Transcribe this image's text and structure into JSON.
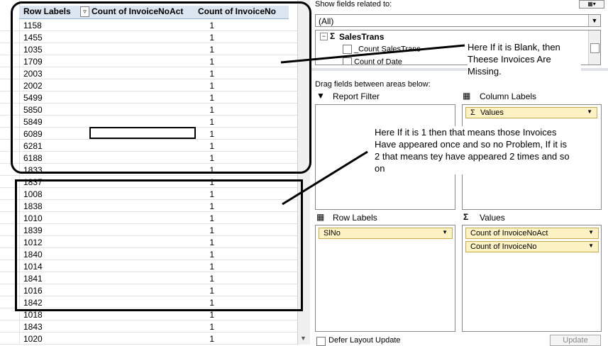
{
  "pivot": {
    "header": {
      "row_labels": "Row Labels",
      "col1": "Count of InvoiceNoAct",
      "col2": "Count of InvoiceNo",
      "filter_icon": "filter-sort-icon"
    },
    "rows": [
      {
        "label": "1158",
        "v1": "1",
        "v2": ""
      },
      {
        "label": "1455",
        "v1": "1",
        "v2": ""
      },
      {
        "label": "1035",
        "v1": "1",
        "v2": ""
      },
      {
        "label": "1709",
        "v1": "1",
        "v2": ""
      },
      {
        "label": "2003",
        "v1": "1",
        "v2": ""
      },
      {
        "label": "2002",
        "v1": "1",
        "v2": ""
      },
      {
        "label": "5499",
        "v1": "1",
        "v2": ""
      },
      {
        "label": "5850",
        "v1": "1",
        "v2": ""
      },
      {
        "label": "5849",
        "v1": "1",
        "v2": ""
      },
      {
        "label": "6089",
        "v1": "1",
        "v2": ""
      },
      {
        "label": "6281",
        "v1": "1",
        "v2": ""
      },
      {
        "label": "6188",
        "v1": "1",
        "v2": ""
      },
      {
        "label": "1833",
        "v1": "1",
        "v2": "1"
      },
      {
        "label": "1837",
        "v1": "1",
        "v2": "1"
      },
      {
        "label": "1008",
        "v1": "1",
        "v2": "1"
      },
      {
        "label": "1838",
        "v1": "1",
        "v2": "1"
      },
      {
        "label": "1010",
        "v1": "1",
        "v2": "1"
      },
      {
        "label": "1839",
        "v1": "1",
        "v2": "1"
      },
      {
        "label": "1012",
        "v1": "1",
        "v2": "1"
      },
      {
        "label": "1840",
        "v1": "1",
        "v2": "1"
      },
      {
        "label": "1014",
        "v1": "1",
        "v2": "1"
      },
      {
        "label": "1841",
        "v1": "1",
        "v2": "1"
      },
      {
        "label": "1016",
        "v1": "1",
        "v2": "1"
      },
      {
        "label": "1842",
        "v1": "1",
        "v2": "1"
      },
      {
        "label": "1018",
        "v1": "1",
        "v2": "1"
      },
      {
        "label": "1843",
        "v1": "1",
        "v2": "1"
      },
      {
        "label": "1020",
        "v1": "1",
        "v2": "1"
      }
    ]
  },
  "annotations": {
    "blank_note": "Here If it is Blank, then Theese Invoices Are Missing.",
    "one_note": "Here If it is 1 then that means those Invoices Have appeared once and so no Problem, If it is 2 that means tey have appeared 2 times and so on"
  },
  "field_list": {
    "show_fields_label": "Show fields related to:",
    "related_value": "(All)",
    "table_name": "SalesTrans",
    "fields": [
      "_Count SalesTrans",
      "Count of Date"
    ],
    "drag_label": "Drag fields between areas below:",
    "report_filter_label": "Report Filter",
    "column_labels_label": "Column Labels",
    "row_labels_label": "Row Labels",
    "values_label": "Values",
    "column_chips": [
      "Values"
    ],
    "row_chips": [
      "SlNo"
    ],
    "value_chips": [
      "Count of InvoiceNoAct",
      "Count of InvoiceNo"
    ],
    "defer_label": "Defer Layout Update",
    "update_label": "Update"
  }
}
